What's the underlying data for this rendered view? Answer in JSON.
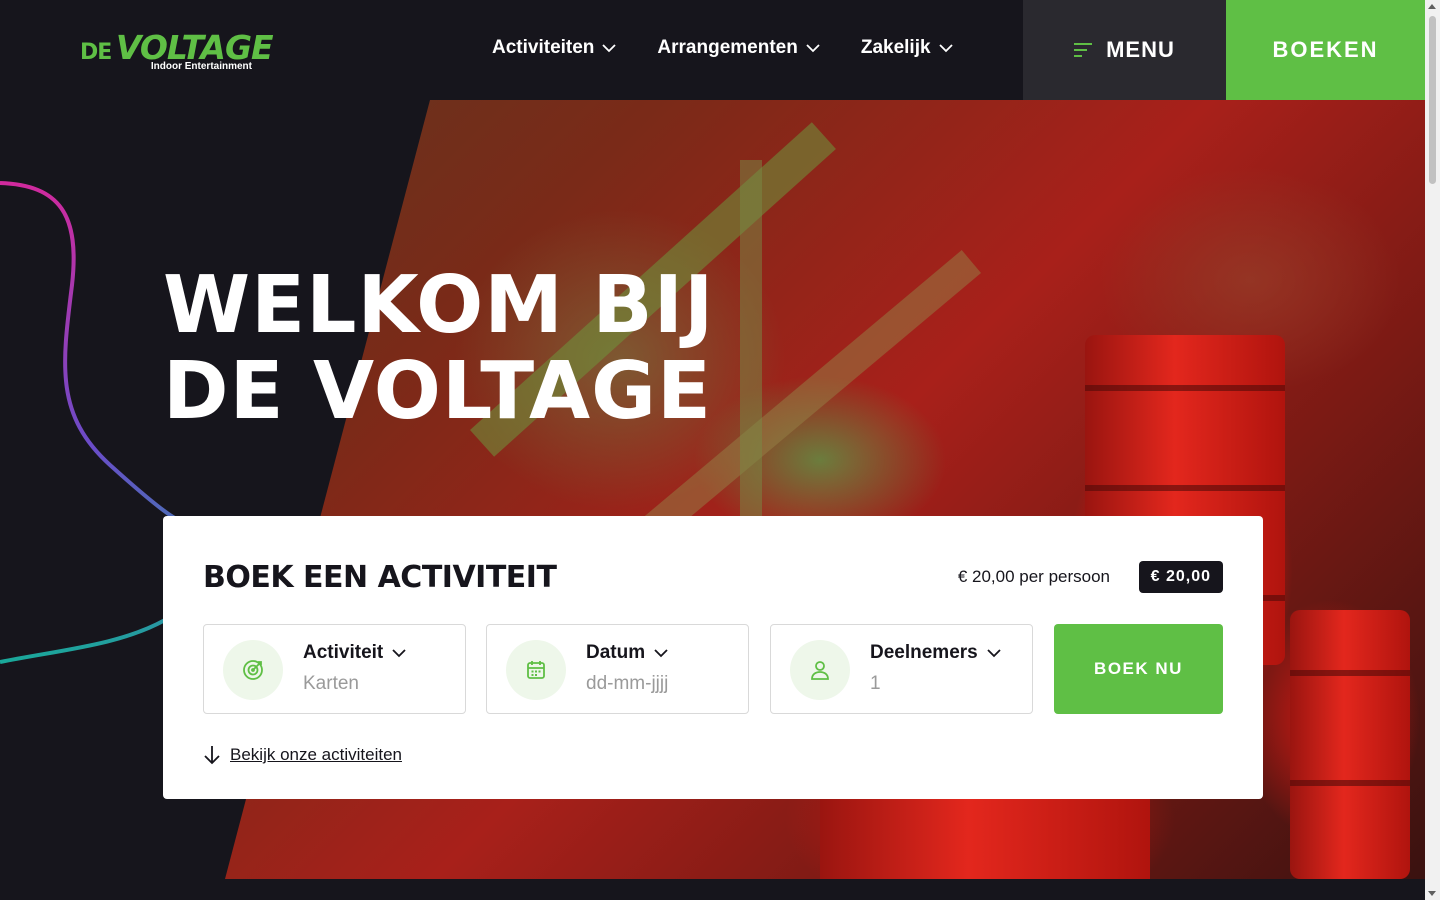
{
  "brand": {
    "logo_de": "DE",
    "logo_voltage": "VOLTAGE",
    "logo_tagline": "Indoor Entertainment",
    "color_green": "#5fbf45",
    "color_dark": "#16151c"
  },
  "nav": {
    "items": [
      {
        "label": "Activiteiten"
      },
      {
        "label": "Arrangementen"
      },
      {
        "label": "Zakelijk"
      }
    ],
    "menu_label": "MENU",
    "book_label": "BOEKEN"
  },
  "hero": {
    "title_line1": "WELKOM BIJ",
    "title_line2": "DE VOLTAGE"
  },
  "booking": {
    "title": "BOEK EEN ACTIVITEIT",
    "price_text": "€ 20,00 per persoon",
    "price_badge": "€ 20,00",
    "fields": {
      "activity": {
        "label": "Activiteit",
        "value": "Karten",
        "icon": "target-icon"
      },
      "date": {
        "label": "Datum",
        "placeholder": "dd-mm-jjjj",
        "icon": "calendar-icon"
      },
      "participants": {
        "label": "Deelnemers",
        "value": "1",
        "icon": "person-icon"
      }
    },
    "submit_label": "BOEK NU",
    "link_label": "Bekijk onze activiteiten"
  }
}
